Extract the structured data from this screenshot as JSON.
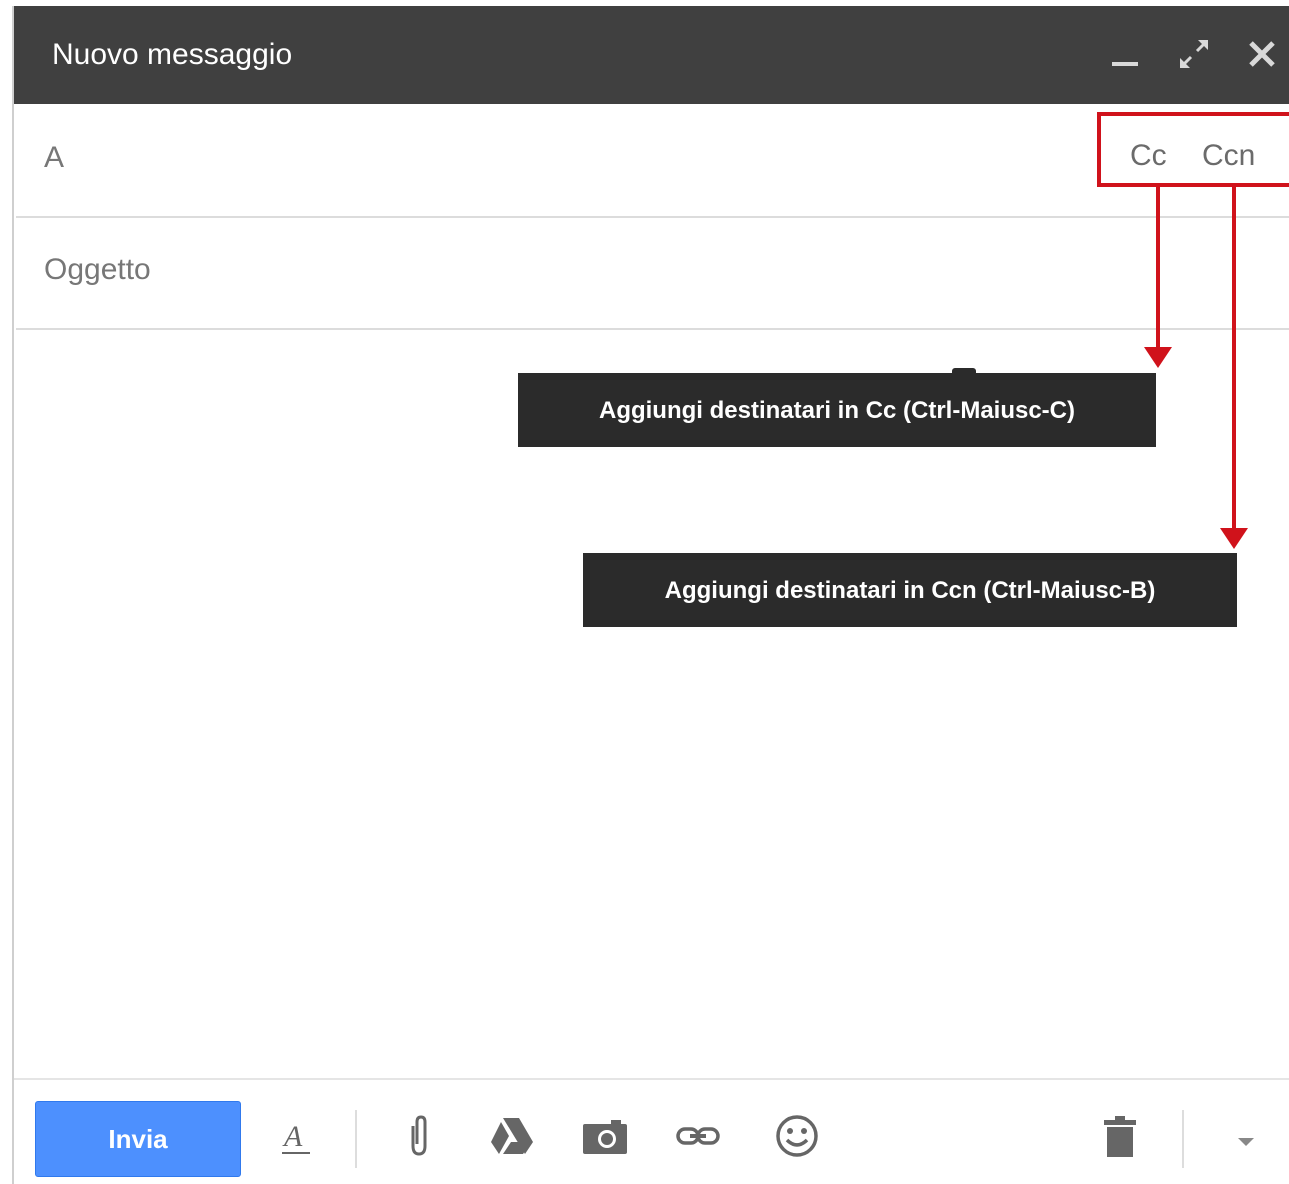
{
  "window": {
    "title": "Nuovo messaggio",
    "controls": [
      "minimize-icon",
      "expand-icon",
      "close-icon"
    ]
  },
  "fields": {
    "to_label": "A",
    "subject_placeholder": "Oggetto",
    "cc_label": "Cc",
    "ccn_label": "Ccn"
  },
  "tooltips": {
    "cc": "Aggiungi destinatari in Cc (Ctrl-Maiusc-C)",
    "ccn": "Aggiungi destinatari in Ccn (Ctrl-Maiusc-B)"
  },
  "toolbar": {
    "send_label": "Invia",
    "tools": [
      "formatting-icon",
      "attach-icon",
      "drive-icon",
      "camera-icon",
      "link-icon",
      "emoji-icon",
      "trash-icon",
      "more-options-icon"
    ]
  },
  "colors": {
    "titlebar": "#404040",
    "send_button": "#4d90fe",
    "annotation": "#d0121b",
    "tooltip": "#2b2b2b"
  }
}
